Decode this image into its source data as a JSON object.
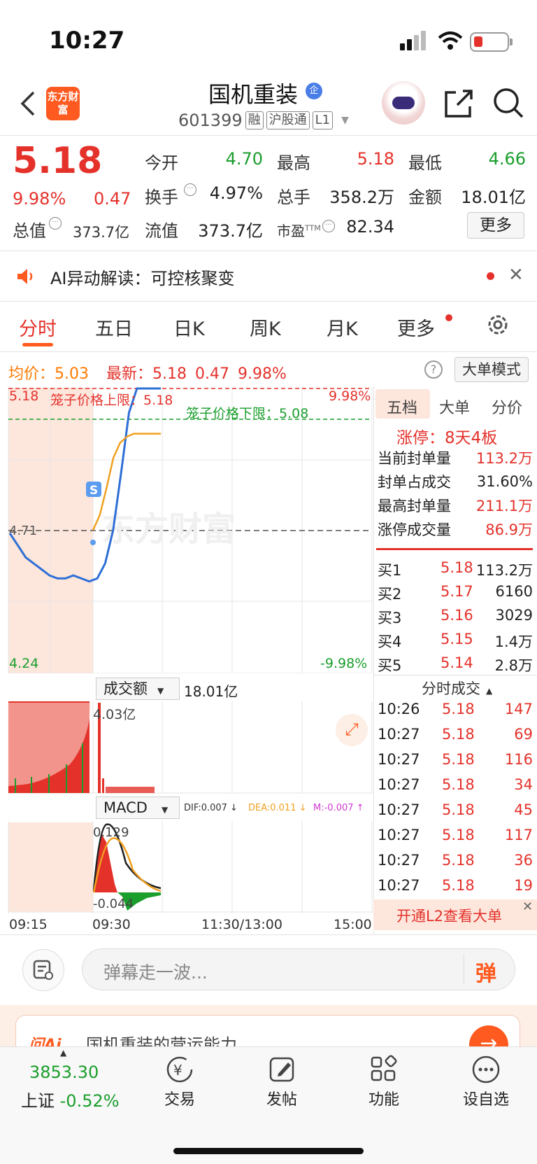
{
  "status": {
    "time": "10:27"
  },
  "header": {
    "logo_text": "东方财富",
    "stock_name": "国机重装",
    "badge": "企",
    "code": "601399",
    "tags": [
      "融",
      "沪股通",
      "L1"
    ]
  },
  "quote": {
    "price": "5.18",
    "change_pct": "9.98%",
    "change": "0.47",
    "stats": [
      {
        "label": "今开",
        "value": "4.70",
        "color": "green"
      },
      {
        "label": "最高",
        "value": "5.18",
        "color": "red"
      },
      {
        "label": "最低",
        "value": "4.66",
        "color": "green"
      },
      {
        "label": "换手",
        "value": "4.97%",
        "color": "default"
      },
      {
        "label": "总手",
        "value": "358.2万",
        "color": "default"
      },
      {
        "label": "金额",
        "value": "18.01亿",
        "color": "default"
      },
      {
        "label": "总值",
        "value": "373.7亿",
        "color": "default"
      },
      {
        "label": "流值",
        "value": "373.7亿",
        "color": "default"
      },
      {
        "label": "市盈",
        "label_sup": "TTM",
        "value": "82.34",
        "color": "default"
      }
    ],
    "more_label": "更多"
  },
  "ai_banner": {
    "text": "AI异动解读：可控核聚变"
  },
  "tabs": [
    "分时",
    "五日",
    "日K",
    "周K",
    "月K",
    "更多"
  ],
  "chart_header": {
    "avg_label": "均价：",
    "avg_value": "5.03",
    "latest_label": "最新：",
    "latest_value": "5.18",
    "change": "0.47",
    "change_pct": "9.98%",
    "big_order_mode": "大单模式"
  },
  "chart_data": {
    "type": "line",
    "title": "",
    "y_axis_left": {
      "top": "5.18",
      "mid": "4.71",
      "bottom": "4.24"
    },
    "y_axis_right": {
      "top": "9.98%",
      "bottom": "-9.98%"
    },
    "annotations": {
      "upper_limit": "笼子价格上限：5.18",
      "lower_limit": "笼子价格下限：5.08",
      "marker": "S"
    },
    "ylim": [
      4.24,
      5.18
    ],
    "x_ticks": [
      "09:15",
      "09:30",
      "11:30/13:00",
      "15:00"
    ],
    "series": [
      {
        "values": [
          4.7,
          4.66,
          4.62,
          4.6,
          4.58,
          4.56,
          4.55,
          4.55,
          4.56,
          4.55,
          4.54,
          4.55,
          4.6,
          4.71,
          4.9,
          5.1,
          5.18,
          5.18,
          5.18,
          5.18
        ]
      },
      {
        "values": [
          4.71,
          4.76,
          4.85,
          4.95,
          5.0,
          5.02,
          5.03,
          5.03,
          5.03,
          5.03,
          5.03
        ]
      }
    ],
    "volume_label": "成交额",
    "volume_total": "18.01亿",
    "volume_max": "4.03亿",
    "macd_label": "MACD",
    "dif": "DIF:0.007 ↓",
    "dea": "DEA:0.011 ↓",
    "m": "M:-0.007 ↑",
    "macd_top": "0.129",
    "macd_bottom": "-0.044"
  },
  "right_panel": {
    "tabs": [
      "五档",
      "大单",
      "分价"
    ],
    "limit_up": "涨停：8天4板",
    "metrics": [
      {
        "label": "当前封单量",
        "value": "113.2万"
      },
      {
        "label": "封单占成交",
        "value": "31.60%"
      },
      {
        "label": "最高封单量",
        "value": "211.1万"
      },
      {
        "label": "涨停成交量",
        "value": "86.9万"
      }
    ],
    "order_book": [
      {
        "label": "买1",
        "price": "5.18",
        "vol": "113.2万"
      },
      {
        "label": "买2",
        "price": "5.17",
        "vol": "6160"
      },
      {
        "label": "买3",
        "price": "5.16",
        "vol": "3029"
      },
      {
        "label": "买4",
        "price": "5.15",
        "vol": "1.4万"
      },
      {
        "label": "买5",
        "price": "5.14",
        "vol": "2.8万"
      }
    ],
    "trades_title": "分时成交",
    "trades": [
      {
        "time": "10:26",
        "price": "5.18",
        "vol": "147"
      },
      {
        "time": "10:27",
        "price": "5.18",
        "vol": "69"
      },
      {
        "time": "10:27",
        "price": "5.18",
        "vol": "116"
      },
      {
        "time": "10:27",
        "price": "5.18",
        "vol": "34"
      },
      {
        "time": "10:27",
        "price": "5.18",
        "vol": "45"
      },
      {
        "time": "10:27",
        "price": "5.18",
        "vol": "117"
      },
      {
        "time": "10:27",
        "price": "5.18",
        "vol": "36"
      },
      {
        "time": "10:27",
        "price": "5.18",
        "vol": "19"
      }
    ],
    "l2_cta": "开通L2查看大单"
  },
  "comment": {
    "placeholder": "弹幕走一波...",
    "danmu_label": "弹"
  },
  "promo": {
    "text": "国机重装的营运能力"
  },
  "bottom_nav": {
    "index_value": "3853.30",
    "index_name": "上证",
    "index_change": "-0.52%",
    "items": [
      "交易",
      "发帖",
      "功能",
      "设自选"
    ]
  }
}
